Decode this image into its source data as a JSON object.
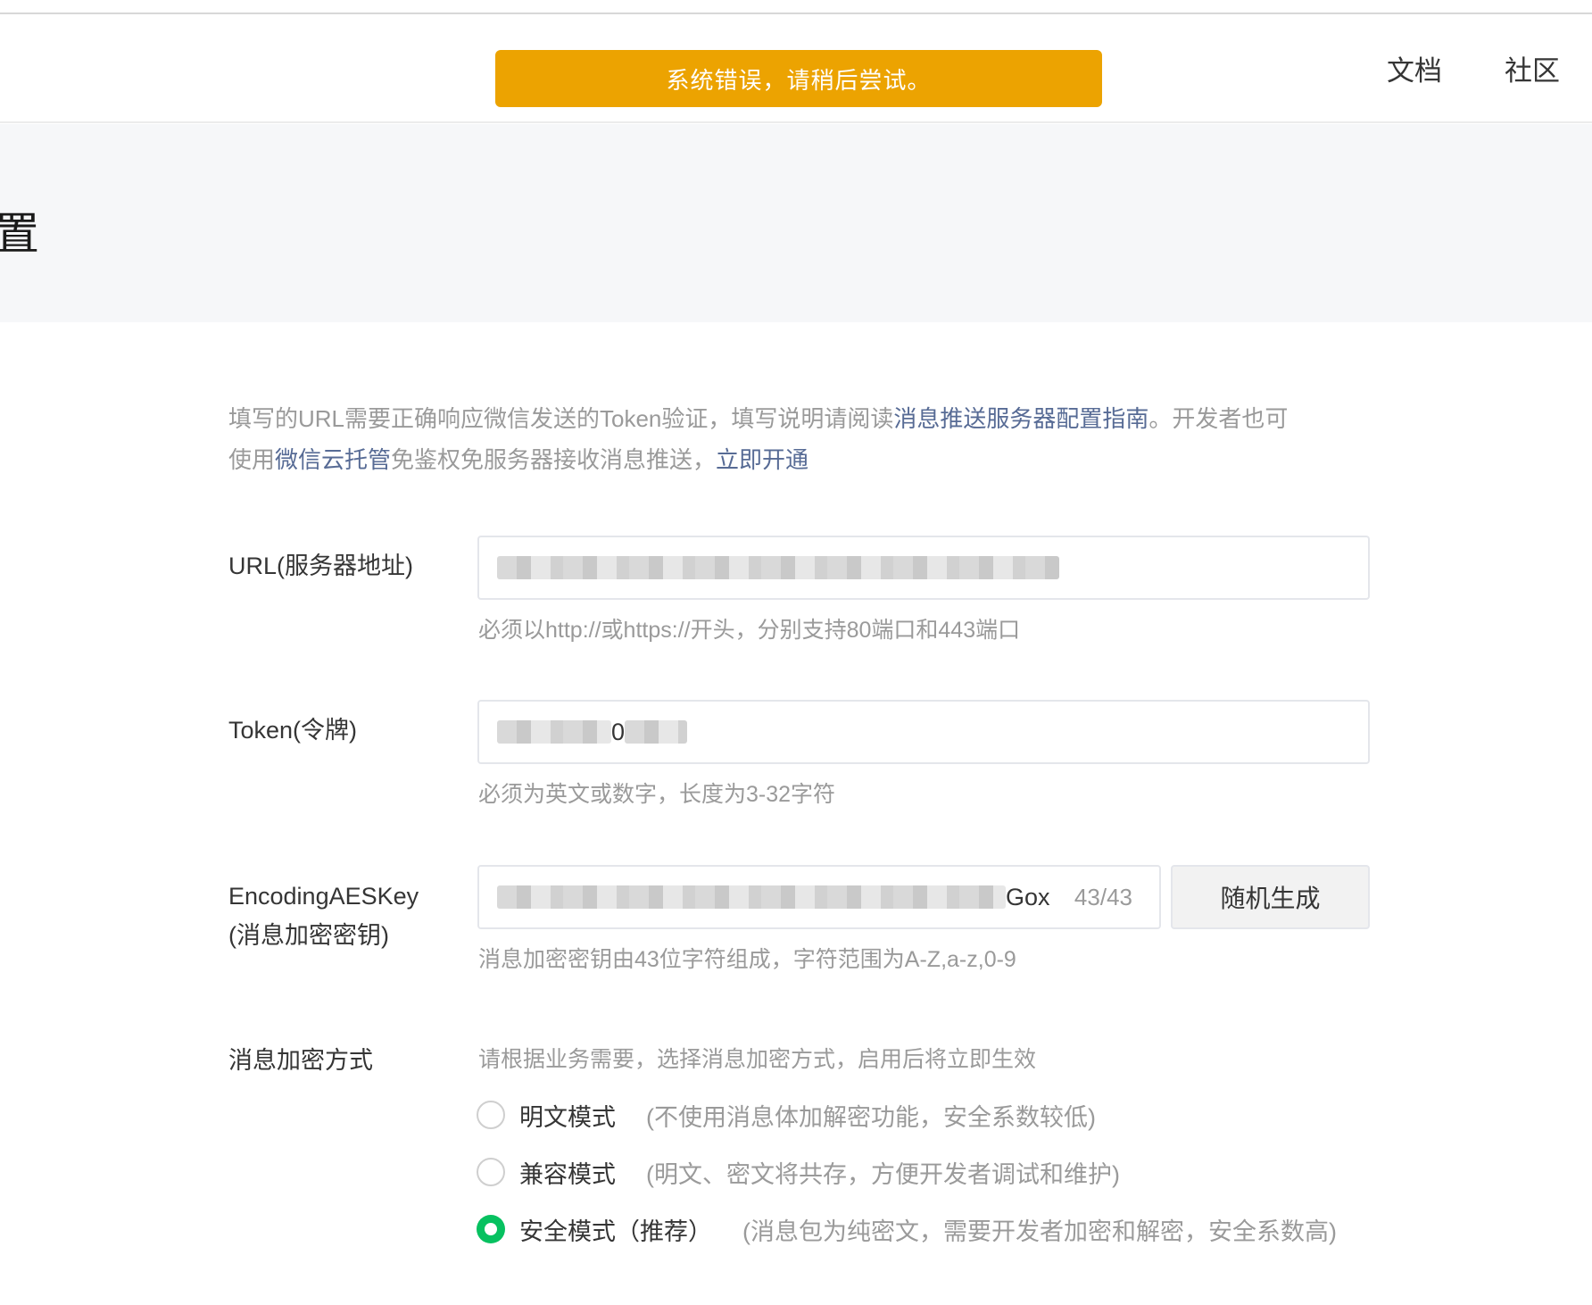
{
  "toast": {
    "message": "系统错误，请稍后尝试。"
  },
  "nav": {
    "docs": "文档",
    "community": "社区"
  },
  "banner": {
    "title_fragment": "置"
  },
  "intro": {
    "p1": "填写的URL需要正确响应微信发送的Token验证，填写说明请阅读",
    "link_guide": "消息推送服务器配置指南",
    "p2": "。开发者也可",
    "p3": "使用",
    "link_cloud": "微信云托管",
    "p4": "免鉴权免服务器接收消息推送，",
    "link_open": "立即开通"
  },
  "url_field": {
    "label": "URL(服务器地址)",
    "hint": "必须以http://或https://开头，分别支持80端口和443端口"
  },
  "token_field": {
    "label": "Token(令牌)",
    "visible_value": "0",
    "hint": "必须为英文或数字，长度为3-32字符"
  },
  "aes_field": {
    "label_line1": "EncodingAESKey",
    "label_line2": "(消息加密密钥)",
    "visible_value": "Gox",
    "counter": "43/43",
    "generate_button": "随机生成",
    "hint": "消息加密密钥由43位字符组成，字符范围为A-Z,a-z,0-9"
  },
  "encryption": {
    "label": "消息加密方式",
    "hint": "请根据业务需要，选择消息加密方式，启用后将立即生效",
    "options": [
      {
        "label": "明文模式",
        "desc": "(不使用消息体加解密功能，安全系数较低)",
        "checked": false
      },
      {
        "label": "兼容模式",
        "desc": "(明文、密文将共存，方便开发者调试和维护)",
        "checked": false
      },
      {
        "label": "安全模式（推荐）",
        "desc": "(消息包为纯密文，需要开发者加密和解密，安全系数高)",
        "checked": true
      }
    ]
  },
  "colors": {
    "toast_bg": "#eca301",
    "link": "#576b95",
    "radio_checked": "#07c160",
    "banner_bg": "#f6f7f9"
  }
}
